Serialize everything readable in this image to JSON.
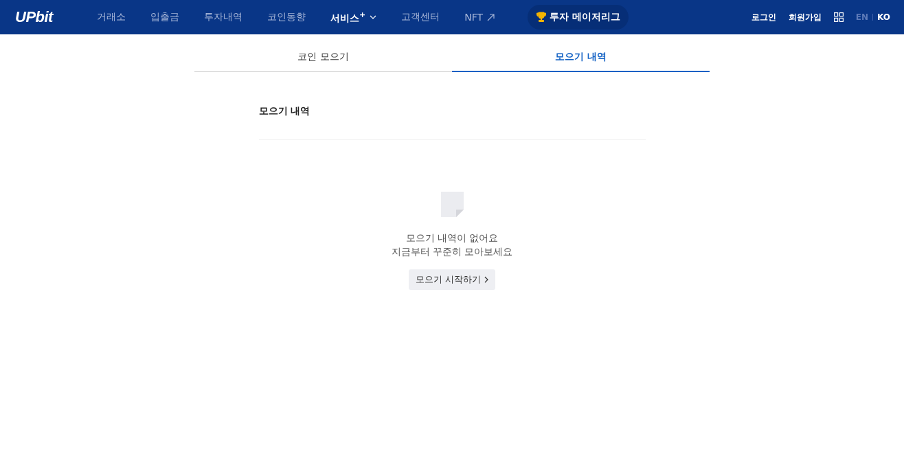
{
  "header": {
    "logo": "UPbit",
    "nav": [
      {
        "label": "거래소",
        "selected": false,
        "kind": "plain"
      },
      {
        "label": "입출금",
        "selected": false,
        "kind": "plain"
      },
      {
        "label": "투자내역",
        "selected": false,
        "kind": "plain"
      },
      {
        "label": "코인동향",
        "selected": false,
        "kind": "plain"
      },
      {
        "label": "서비스$^{+}$",
        "selected": true,
        "kind": "dropdown"
      },
      {
        "label": "고객센터",
        "selected": false,
        "kind": "plain"
      },
      {
        "label": "NFT",
        "selected": false,
        "kind": "external"
      }
    ],
    "promo": "투자 메이저리그",
    "auth": [
      "로그인",
      "회원가입"
    ],
    "languages": [
      {
        "label": "EN",
        "selected": false
      },
      {
        "label": "KO",
        "selected": true
      }
    ]
  },
  "tabs": [
    {
      "label": "코인 모으기",
      "selected": false
    },
    {
      "label": "모으기 내역",
      "selected": true
    }
  ],
  "section": {
    "title": "모으기 내역",
    "empty": {
      "lines": [
        "모으기 내역이 없어요",
        "지금부터 꾸준히 모아보세요"
      ],
      "button": "모으기 시작하기"
    }
  }
}
